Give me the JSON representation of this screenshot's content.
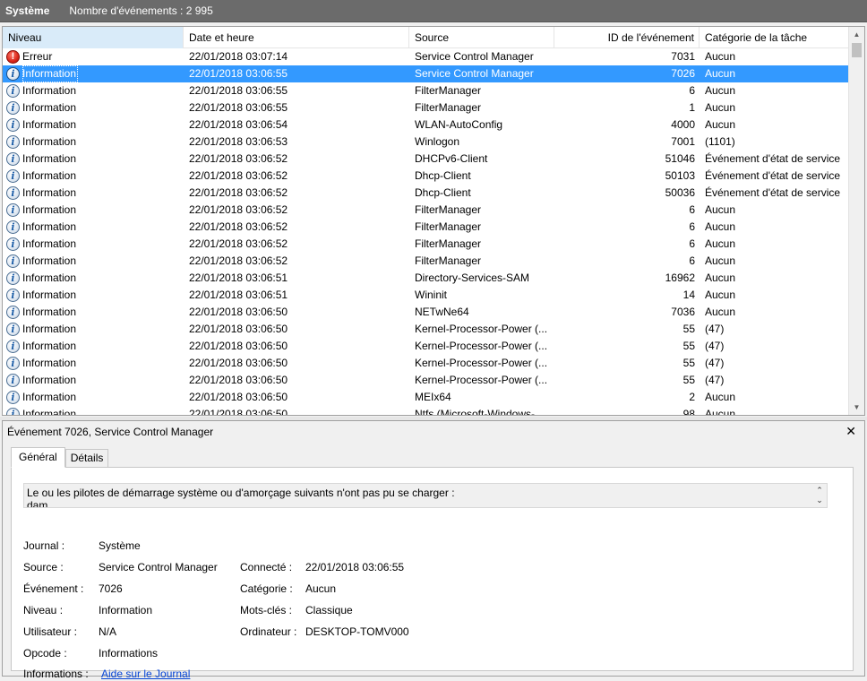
{
  "titlebar": {
    "log_name": "Système",
    "event_count": "Nombre d'événements : 2 995"
  },
  "columns": {
    "level": "Niveau",
    "date": "Date et heure",
    "source": "Source",
    "event_id": "ID de l'événement",
    "category": "Catégorie de la tâche"
  },
  "events": [
    {
      "level": "Erreur",
      "icon": "error-icon",
      "date": "22/01/2018 03:07:14",
      "source": "Service Control Manager",
      "id": "7031",
      "category": "Aucun"
    },
    {
      "level": "Information",
      "icon": "info-icon",
      "date": "22/01/2018 03:06:55",
      "source": "Service Control Manager",
      "id": "7026",
      "category": "Aucun",
      "selected": true
    },
    {
      "level": "Information",
      "icon": "info-icon",
      "date": "22/01/2018 03:06:55",
      "source": "FilterManager",
      "id": "6",
      "category": "Aucun"
    },
    {
      "level": "Information",
      "icon": "info-icon",
      "date": "22/01/2018 03:06:55",
      "source": "FilterManager",
      "id": "1",
      "category": "Aucun"
    },
    {
      "level": "Information",
      "icon": "info-icon",
      "date": "22/01/2018 03:06:54",
      "source": "WLAN-AutoConfig",
      "id": "4000",
      "category": "Aucun"
    },
    {
      "level": "Information",
      "icon": "info-icon",
      "date": "22/01/2018 03:06:53",
      "source": "Winlogon",
      "id": "7001",
      "category": "(1101)"
    },
    {
      "level": "Information",
      "icon": "info-icon",
      "date": "22/01/2018 03:06:52",
      "source": "DHCPv6-Client",
      "id": "51046",
      "category": "Événement d'état de service"
    },
    {
      "level": "Information",
      "icon": "info-icon",
      "date": "22/01/2018 03:06:52",
      "source": "Dhcp-Client",
      "id": "50103",
      "category": "Événement d'état de service"
    },
    {
      "level": "Information",
      "icon": "info-icon",
      "date": "22/01/2018 03:06:52",
      "source": "Dhcp-Client",
      "id": "50036",
      "category": "Événement d'état de service"
    },
    {
      "level": "Information",
      "icon": "info-icon",
      "date": "22/01/2018 03:06:52",
      "source": "FilterManager",
      "id": "6",
      "category": "Aucun"
    },
    {
      "level": "Information",
      "icon": "info-icon",
      "date": "22/01/2018 03:06:52",
      "source": "FilterManager",
      "id": "6",
      "category": "Aucun"
    },
    {
      "level": "Information",
      "icon": "info-icon",
      "date": "22/01/2018 03:06:52",
      "source": "FilterManager",
      "id": "6",
      "category": "Aucun"
    },
    {
      "level": "Information",
      "icon": "info-icon",
      "date": "22/01/2018 03:06:52",
      "source": "FilterManager",
      "id": "6",
      "category": "Aucun"
    },
    {
      "level": "Information",
      "icon": "info-icon",
      "date": "22/01/2018 03:06:51",
      "source": "Directory-Services-SAM",
      "id": "16962",
      "category": "Aucun"
    },
    {
      "level": "Information",
      "icon": "info-icon",
      "date": "22/01/2018 03:06:51",
      "source": "Wininit",
      "id": "14",
      "category": "Aucun"
    },
    {
      "level": "Information",
      "icon": "info-icon",
      "date": "22/01/2018 03:06:50",
      "source": "NETwNe64",
      "id": "7036",
      "category": "Aucun"
    },
    {
      "level": "Information",
      "icon": "info-icon",
      "date": "22/01/2018 03:06:50",
      "source": "Kernel-Processor-Power (...",
      "id": "55",
      "category": "(47)"
    },
    {
      "level": "Information",
      "icon": "info-icon",
      "date": "22/01/2018 03:06:50",
      "source": "Kernel-Processor-Power (...",
      "id": "55",
      "category": "(47)"
    },
    {
      "level": "Information",
      "icon": "info-icon",
      "date": "22/01/2018 03:06:50",
      "source": "Kernel-Processor-Power (...",
      "id": "55",
      "category": "(47)"
    },
    {
      "level": "Information",
      "icon": "info-icon",
      "date": "22/01/2018 03:06:50",
      "source": "Kernel-Processor-Power (...",
      "id": "55",
      "category": "(47)"
    },
    {
      "level": "Information",
      "icon": "info-icon",
      "date": "22/01/2018 03:06:50",
      "source": "MEIx64",
      "id": "2",
      "category": "Aucun"
    },
    {
      "level": "Information",
      "icon": "info-icon",
      "date": "22/01/2018 03:06:50",
      "source": "Ntfs (Microsoft-Windows-...",
      "id": "98",
      "category": "Aucun"
    }
  ],
  "detail": {
    "title": "Événement 7026, Service Control Manager",
    "close": "✕",
    "tabs": [
      "Général",
      "Détails"
    ],
    "description_line1": "Le ou les pilotes de démarrage système ou d'amorçage suivants n'ont pas pu se charger :",
    "description_line2": "dam",
    "labels": {
      "journal": "Journal :",
      "source": "Source :",
      "evenement": "Événement :",
      "niveau": "Niveau :",
      "utilisateur": "Utilisateur :",
      "opcode": "Opcode :",
      "informations": "Informations :",
      "connecte": "Connecté :",
      "categorie": "Catégorie :",
      "mots_cles": "Mots-clés :",
      "ordinateur": "Ordinateur :"
    },
    "values": {
      "journal": "Système",
      "source": "Service Control Manager",
      "evenement": "7026",
      "niveau": "Information",
      "utilisateur": "N/A",
      "opcode": "Informations",
      "informations": "Aide sur le Journal",
      "connecte": "22/01/2018 03:06:55",
      "categorie": "Aucun",
      "mots_cles": "Classique",
      "ordinateur": "DESKTOP-TOMV000"
    }
  }
}
